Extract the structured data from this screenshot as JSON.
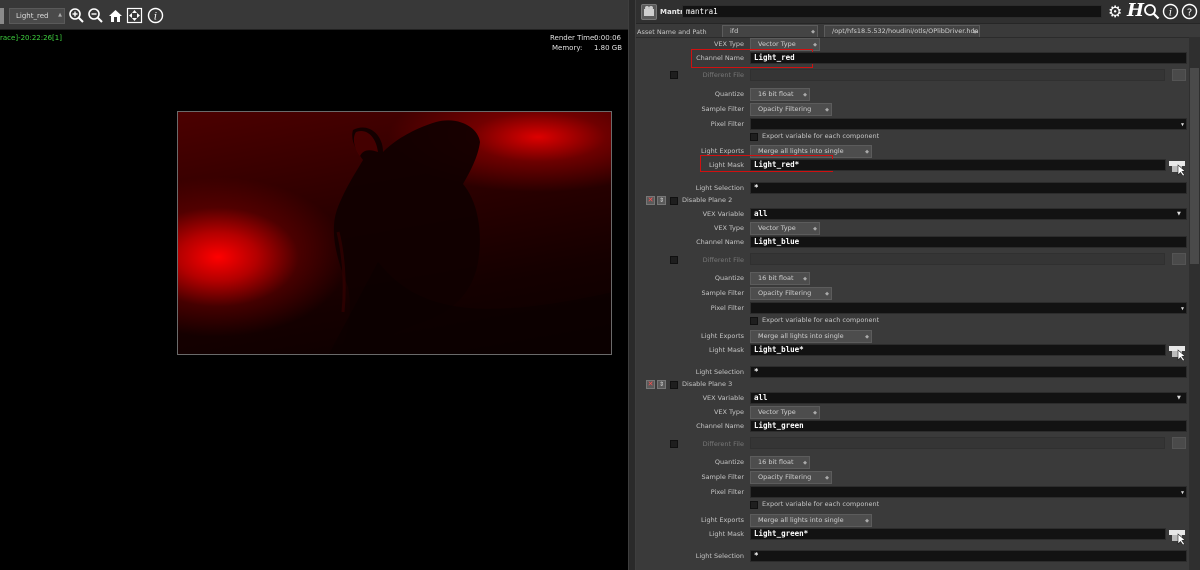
{
  "viewer": {
    "toolbar": {
      "display_option": "Light_red"
    },
    "status_left": "race]-20:22:26[1]",
    "render_time_label": "Render Time:",
    "render_time_value": "0:00:06",
    "memory_label": "Memory:",
    "memory_value": "1.80 GB"
  },
  "node": {
    "type_label": "Mantra",
    "name": "mantra1",
    "asset_label": "Asset Name and Path",
    "asset_name": "ifd",
    "asset_path": "/opt/hfs18.5.532/houdini/otls/OPlibDriver.hda"
  },
  "plane1": {
    "vex_type_label": "VEX Type",
    "vex_type": "Vector Type",
    "channel_label": "Channel Name",
    "channel": "Light_red",
    "diff_file_label": "Different File",
    "quantize_label": "Quantize",
    "quantize": "16 bit float",
    "sample_filter_label": "Sample Filter",
    "sample_filter": "Opacity Filtering",
    "pixel_filter_label": "Pixel Filter",
    "export_label": "Export variable for each component",
    "light_exports_label": "Light Exports",
    "light_exports": "Merge all lights into single channel",
    "light_mask_label": "Light Mask",
    "light_mask": "Light_red*",
    "light_sel_label": "Light Selection",
    "light_sel": "*"
  },
  "plane2": {
    "disable_label": "Disable Plane 2",
    "vex_var_label": "VEX Variable",
    "vex_var": "all",
    "vex_type_label": "VEX Type",
    "vex_type": "Vector Type",
    "channel_label": "Channel Name",
    "channel": "Light_blue",
    "diff_file_label": "Different File",
    "quantize_label": "Quantize",
    "quantize": "16 bit float",
    "sample_filter_label": "Sample Filter",
    "sample_filter": "Opacity Filtering",
    "pixel_filter_label": "Pixel Filter",
    "export_label": "Export variable for each component",
    "light_exports_label": "Light Exports",
    "light_exports": "Merge all lights into single channel",
    "light_mask_label": "Light Mask",
    "light_mask": "Light_blue*",
    "light_sel_label": "Light Selection",
    "light_sel": "*"
  },
  "plane3": {
    "disable_label": "Disable Plane 3",
    "vex_var_label": "VEX Variable",
    "vex_var": "all",
    "vex_type_label": "VEX Type",
    "vex_type": "Vector Type",
    "channel_label": "Channel Name",
    "channel": "Light_green",
    "diff_file_label": "Different File",
    "quantize_label": "Quantize",
    "quantize": "16 bit float",
    "sample_filter_label": "Sample Filter",
    "sample_filter": "Opacity Filtering",
    "pixel_filter_label": "Pixel Filter",
    "export_label": "Export variable for each component",
    "light_exports_label": "Light Exports",
    "light_exports": "Merge all lights into single channel",
    "light_mask_label": "Light Mask",
    "light_mask": "Light_green*",
    "light_sel_label": "Light Selection",
    "light_sel": "*"
  },
  "colors": {
    "highlight": "#d01010",
    "status_green": "#3fd23f",
    "panel_bg": "#3a3a3a",
    "field_bg": "#121212"
  },
  "icons": [
    "zoom-in-icon",
    "zoom-out-icon",
    "home-icon",
    "fit-view-icon",
    "info-icon",
    "gear-icon",
    "houdini-h-icon",
    "search-icon",
    "help-icon",
    "mantra-node-icon",
    "delete-icon",
    "move-icon",
    "folder-icon"
  ]
}
